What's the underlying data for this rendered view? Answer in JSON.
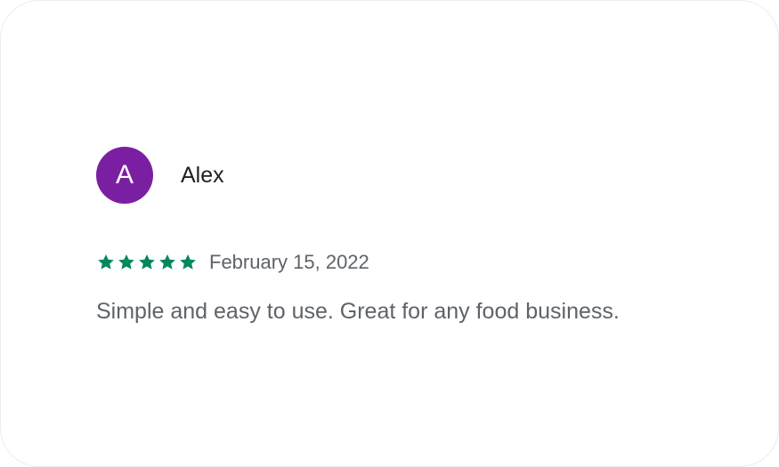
{
  "review": {
    "reviewer_initial": "A",
    "reviewer_name": "Alex",
    "avatar_color": "#7b1fa2",
    "rating": 5,
    "max_rating": 5,
    "star_color": "#01875f",
    "date": "February 15, 2022",
    "text": "Simple and easy to use. Great for any food business."
  }
}
